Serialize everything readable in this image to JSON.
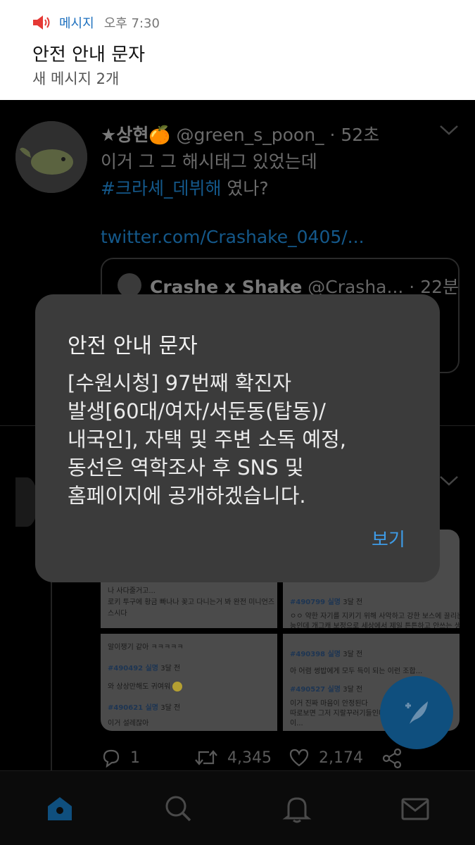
{
  "notification": {
    "app_name": "메시지",
    "time": "오후 7:30",
    "title": "안전 안내 문자",
    "subtitle": "새 메시지 2개"
  },
  "feed": {
    "tweet": {
      "display_name": "★상현🍊",
      "handle": "@green_s_poon_",
      "time": "· 52초",
      "text_line1": "이거 그 그 해시태그 있었는데",
      "hashtag": "#크라셰_데뷔해",
      "text_line2_rest": " 였나?",
      "link": "twitter.com/Crashake_0405/...",
      "quote": {
        "display_name": "Crashe x Shake",
        "handle": "@Crasha...",
        "time": "· 22분"
      }
    },
    "media_tiles": {
      "tile1_line1": "나 사다줄거고...",
      "tile1_line2": "로키 투구에 황금 빠나나 꽂고 다니는거 봐 완전 미니언즈 맞춤형 뿌",
      "tile1_line3": "스시다",
      "tile2_id": "#490799 실명",
      "tile2_meta": "3달 전",
      "tile2_line1": "ㅇㅇ 약한 자기를 지키기 위해 사악하고 강한 보스에 끌리는 본",
      "tile2_line2": "능인데 개그캐 보정으로 세상에서 제일 튼튼하고 안쓰는 생물체",
      "tile3_line1": "알이쟁기 같아 ㅋㅋㅋㅋㅋ",
      "tile3_id1": "#490492 실명",
      "tile3_meta1": "3달 전",
      "tile3_line2": "와 상상만해도 귀여워",
      "tile3_id2": "#490621 실명",
      "tile3_meta2": "3달 전",
      "tile3_line3": "이거 설레잖아",
      "tile4_id1": "#490398 실명",
      "tile4_meta1": "3달 전",
      "tile4_line1": "아 어렴 썽밥에게 모두 득이 되는 이런 조합...",
      "tile4_id2": "#490527 실명",
      "tile4_meta2": "3달 전",
      "tile4_line2": "이거 진짜 마음이 안정된다",
      "tile4_line3": "따로보면 그저 지랄꾸러기들인데",
      "tile4_line4": "이..."
    },
    "actions": {
      "replies": "1",
      "retweets": "4,345",
      "likes": "2,174"
    }
  },
  "dialog": {
    "title": "안전 안내 문자",
    "body": "[수원시청] 97번째 확진자\n발생[60대/여자/서둔동(탑동)/\n내국인], 자택 및 주변 소독 예정,\n동선은 역학조사 후 SNS 및\n홈페이지에 공개하겠습니다.",
    "view_button": "보기"
  },
  "colors": {
    "accent": "#3e9be6",
    "notification_app": "#1c6fbe",
    "dialog_bg": "#3b3b3b",
    "speaker_red": "#e53935"
  },
  "icons": {
    "notification": "speaker-icon",
    "nav": [
      "home-icon",
      "search-icon",
      "bell-icon",
      "mail-icon"
    ],
    "actions": [
      "reply-icon",
      "retweet-icon",
      "like-icon",
      "share-icon"
    ],
    "fab": "compose-tweet-icon"
  }
}
